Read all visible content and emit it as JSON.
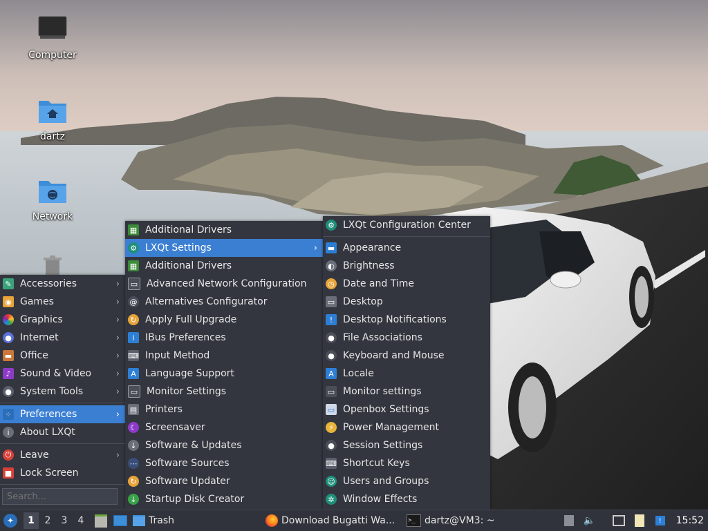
{
  "desktop": {
    "icons": [
      {
        "label": "Computer"
      },
      {
        "label": "dartz"
      },
      {
        "label": "Network"
      }
    ]
  },
  "main_menu": {
    "categories": [
      {
        "label": "Accessories"
      },
      {
        "label": "Games"
      },
      {
        "label": "Graphics"
      },
      {
        "label": "Internet"
      },
      {
        "label": "Office"
      },
      {
        "label": "Sound & Video"
      },
      {
        "label": "System Tools"
      }
    ],
    "preferences": "Preferences",
    "about": "About LXQt",
    "leave": "Leave",
    "lock": "Lock Screen",
    "search_placeholder": "Search..."
  },
  "preferences_menu": {
    "items": [
      {
        "label": "Additional Drivers"
      },
      {
        "label": "LXQt Settings"
      },
      {
        "label": "Additional Drivers"
      },
      {
        "label": "Advanced Network Configuration"
      },
      {
        "label": "Alternatives Configurator"
      },
      {
        "label": "Apply Full Upgrade"
      },
      {
        "label": "IBus Preferences"
      },
      {
        "label": "Input Method"
      },
      {
        "label": "Language Support"
      },
      {
        "label": "Monitor Settings"
      },
      {
        "label": "Printers"
      },
      {
        "label": "Screensaver"
      },
      {
        "label": "Software & Updates"
      },
      {
        "label": "Software Sources"
      },
      {
        "label": "Software Updater"
      },
      {
        "label": "Startup Disk Creator"
      }
    ]
  },
  "lxqt_settings_menu": {
    "header": "LXQt Configuration Center",
    "items": [
      {
        "label": "Appearance"
      },
      {
        "label": "Brightness"
      },
      {
        "label": "Date and Time"
      },
      {
        "label": "Desktop"
      },
      {
        "label": "Desktop Notifications"
      },
      {
        "label": "File Associations"
      },
      {
        "label": "Keyboard and Mouse"
      },
      {
        "label": "Locale"
      },
      {
        "label": "Monitor settings"
      },
      {
        "label": "Openbox Settings"
      },
      {
        "label": "Power Management"
      },
      {
        "label": "Session Settings"
      },
      {
        "label": "Shortcut Keys"
      },
      {
        "label": "Users and Groups"
      },
      {
        "label": "Window Effects"
      }
    ]
  },
  "taskbar": {
    "workspaces": [
      "1",
      "2",
      "3",
      "4"
    ],
    "trash_label": "Trash",
    "tasks": [
      {
        "label": "Download Bugatti Wa..."
      },
      {
        "label": "dartz@VM3: ~"
      }
    ],
    "clock": "15:52"
  },
  "colors": {
    "menu_bg": "#33363f",
    "selection": "#3b7fd3",
    "taskbar_bg": "#30333b"
  }
}
